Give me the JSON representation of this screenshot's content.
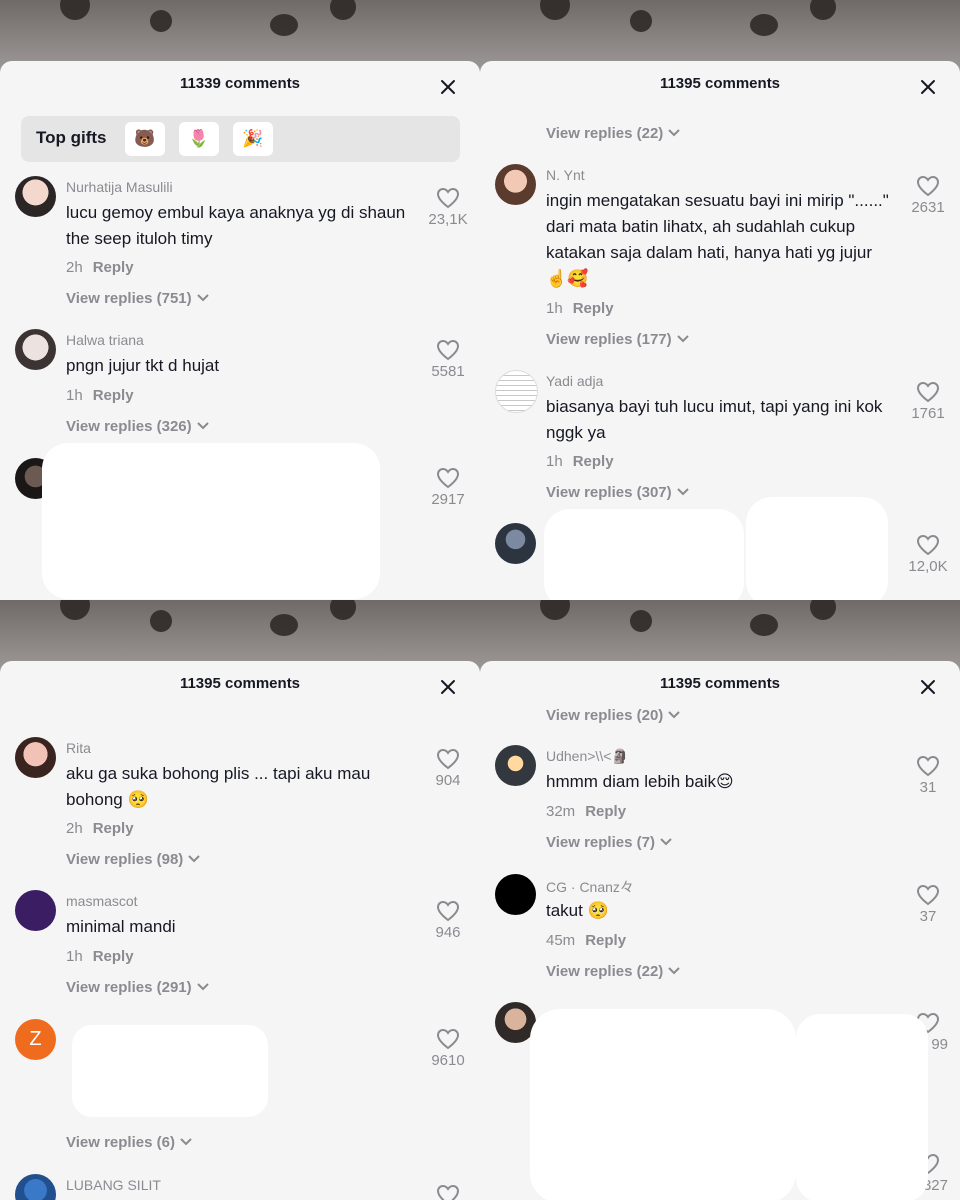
{
  "panels": [
    {
      "comment_count": "11339 comments",
      "top_gifts": {
        "label": "Top gifts",
        "gifts": [
          "🐻",
          "🌷",
          "🎉"
        ]
      },
      "comments": [
        {
          "name": "Nurhatija Masulili",
          "text": "lucu gemoy embul kaya anaknya yg di shaun the seep ituloh timy",
          "time": "2h",
          "reply": "Reply",
          "replies": "View replies (751)",
          "likes": "23,1K"
        },
        {
          "name": "Halwa triana",
          "text": "pngn jujur tkt d hujat",
          "time": "1h",
          "reply": "Reply",
          "replies": "View replies (326)",
          "likes": "5581"
        },
        {
          "likes": "2917"
        }
      ]
    },
    {
      "comment_count": "11395 comments",
      "top_replies": "View replies (22)",
      "comments": [
        {
          "name": "N. Ynt",
          "text": "ingin mengatakan sesuatu bayi ini mirip \"......\" dari mata batin lihatx, ah sudahlah cukup katakan saja dalam hati, hanya hati yg jujur ☝️🥰",
          "time": "1h",
          "reply": "Reply",
          "replies": "View replies (177)",
          "likes": "2631"
        },
        {
          "name": "Yadi adja",
          "text": "biasanya bayi tuh lucu imut, tapi yang ini kok nggk ya",
          "time": "1h",
          "reply": "Reply",
          "replies": "View replies (307)",
          "likes": "1761"
        },
        {
          "likes": "12,0K"
        }
      ]
    },
    {
      "comment_count": "11395 comments",
      "comments": [
        {
          "name": "Rita",
          "text": "aku ga suka bohong plis ... tapi aku mau bohong 🥺",
          "time": "2h",
          "reply": "Reply",
          "replies": "View replies (98)",
          "likes": "904"
        },
        {
          "name": "masmascot",
          "text": "minimal mandi",
          "time": "1h",
          "reply": "Reply",
          "replies": "View replies (291)",
          "likes": "946"
        },
        {
          "avatar_letter": "Z",
          "replies": "View replies (6)",
          "likes": "9610"
        },
        {
          "name": "LUBANG SILIT"
        }
      ]
    },
    {
      "comment_count": "11395 comments",
      "top_replies": "View replies (20)",
      "comments": [
        {
          "name": "Udhen>\\\\<🗿",
          "text": "hmmm diam lebih baik😌",
          "time": "32m",
          "reply": "Reply",
          "replies": "View replies (7)",
          "likes": "31"
        },
        {
          "name": "CG · Cnanz々",
          "text": "takut 🥺",
          "time": "45m",
          "reply": "Reply",
          "replies": "View replies (22)",
          "likes": "37"
        },
        {
          "likes_partial": "99"
        },
        {
          "likes_partial": "327"
        }
      ]
    }
  ],
  "colors": {
    "sheet_bg": "#f6f5f5",
    "primary_text": "#161823",
    "secondary_text": "#8a8b91",
    "gift_bar_bg": "#e6e5e6"
  },
  "icons": [
    "close-icon",
    "heart-outline-icon",
    "chevron-down-icon"
  ]
}
